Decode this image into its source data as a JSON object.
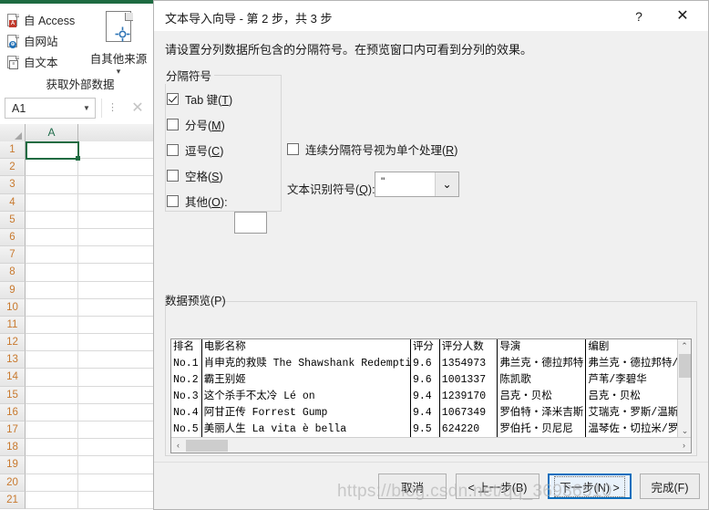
{
  "excel": {
    "ribbon": {
      "group_label": "获取外部数据",
      "small_buttons": [
        {
          "label": "自 Access",
          "icon": "access-database-icon"
        },
        {
          "label": "自网站",
          "icon": "web-globe-icon"
        },
        {
          "label": "自文本",
          "icon": "text-file-icon"
        }
      ],
      "big_button": {
        "label": "自其他来源",
        "icon": "other-sources-icon",
        "caret": "▾"
      }
    },
    "namebox": {
      "value": "A1",
      "caret": "▼",
      "cancel_icon": "close-icon",
      "more_icon": "vertical-dots-icon"
    },
    "grid": {
      "column_headers": [
        "A"
      ],
      "row_numbers": [
        "1",
        "2",
        "3",
        "4",
        "5",
        "6",
        "7",
        "8",
        "9",
        "10",
        "11",
        "12",
        "13",
        "14",
        "15",
        "16",
        "17",
        "18",
        "19",
        "20",
        "21"
      ],
      "selected_cell": "A1"
    }
  },
  "dialog": {
    "title": "文本导入向导 - 第 2 步，共 3 步",
    "help_icon": "?",
    "close_icon": "✕",
    "instruction": "请设置分列数据所包含的分隔符号。在预览窗口内可看到分列的效果。",
    "delimiters": {
      "legend": "分隔符号",
      "items": [
        {
          "label_pre": "Tab 键(",
          "accel": "T",
          "label_post": ")",
          "checked": true
        },
        {
          "label_pre": "分号(",
          "accel": "M",
          "label_post": ")",
          "checked": false
        },
        {
          "label_pre": "逗号(",
          "accel": "C",
          "label_post": ")",
          "checked": false
        },
        {
          "label_pre": "空格(",
          "accel": "S",
          "label_post": ")",
          "checked": false
        },
        {
          "label_pre": "其他(",
          "accel": "O",
          "label_post": "):",
          "checked": false
        }
      ],
      "other_value": ""
    },
    "consecutive": {
      "label_pre": "连续分隔符号视为单个处理(",
      "accel": "R",
      "label_post": ")",
      "checked": false
    },
    "qualifier": {
      "label_pre": "文本识别符号(",
      "accel": "Q",
      "label_post": "):",
      "value": "\"",
      "caret": "⌄"
    },
    "preview": {
      "legend": "数据预览(P)",
      "headers": [
        "排名",
        "电影名称",
        "评分",
        "评分人数",
        "导演",
        "编剧"
      ],
      "rows": [
        [
          "No.1",
          "肖申克的救赎 The Shawshank Redemption",
          "9.6",
          "1354973",
          "弗兰克・德拉邦特",
          "弗兰克・德拉邦特/斯"
        ],
        [
          "No.2",
          "霸王别姬",
          "9.6",
          "1001337",
          "陈凯歌",
          "芦苇/李碧华"
        ],
        [
          "No.3",
          "这个杀手不太冷 Lé on",
          "9.4",
          "1239170",
          "吕克・贝松",
          "吕克・贝松"
        ],
        [
          "No.4",
          "阿甘正传 Forrest Gump",
          "9.4",
          "1067349",
          "罗伯特・泽米吉斯",
          "艾瑞克・罗斯/温斯顿"
        ],
        [
          "No.5",
          "美丽人生 La vita è  bella",
          "9.5",
          "624220",
          "罗伯托・贝尼尼",
          "温琴佐・切拉米/罗伯"
        ]
      ],
      "vscroll": {
        "up": "⌃",
        "down": "⌄"
      },
      "hscroll": {
        "left": "‹",
        "right": "›"
      }
    },
    "buttons": {
      "cancel": "取消",
      "back": "< 上一步(B)",
      "next": "下一步(N) >",
      "finish": "完成(F)"
    }
  },
  "watermark": "https://blog.csdn.net/qq_36936510"
}
